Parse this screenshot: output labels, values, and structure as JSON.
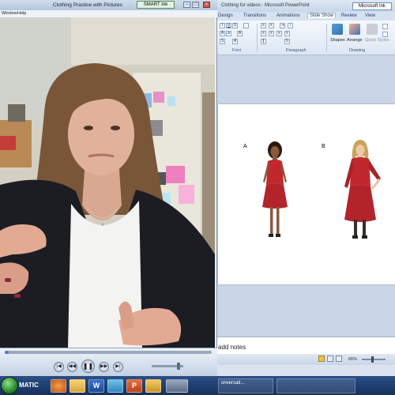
{
  "video_window": {
    "title": "Clothing Practice with Pictures",
    "smart_ink": "SMART Ink",
    "menu": [
      "Window",
      "Help"
    ],
    "controls": {
      "prev": "previous-icon",
      "rewind": "rewind-icon",
      "play_pause": "pause-icon",
      "fast_forward": "fast-forward-icon",
      "next": "next-icon"
    },
    "playback_progress": 0.02,
    "volume_level": 0.85
  },
  "ppt_window": {
    "title": "Clothing for videos - Microsoft PowerPoint",
    "smart_ink": "Microsoft Ink",
    "tabs": [
      "Design",
      "Transitions",
      "Animations",
      "Slide Show",
      "Review",
      "View"
    ],
    "active_tab": "Slide Show",
    "ribbon_groups": [
      "Font",
      "Paragraph",
      "Drawing"
    ],
    "ribbon_buttons": [
      "Shapes",
      "Arrange",
      "Quick Styles"
    ],
    "slide": {
      "label_a": "A",
      "label_b": "B"
    },
    "notes_placeholder": "add notes",
    "zoom": "66%"
  },
  "taskbar": {
    "start_label": "MATIC",
    "apps": [
      {
        "name": "firefox",
        "glyph": ""
      },
      {
        "name": "folder",
        "glyph": ""
      },
      {
        "name": "word",
        "glyph": "W"
      },
      {
        "name": "paint",
        "glyph": ""
      },
      {
        "name": "powerpoint",
        "glyph": "P"
      },
      {
        "name": "folder2",
        "glyph": ""
      },
      {
        "name": "video",
        "glyph": ""
      }
    ],
    "window_preview": "onversati..."
  },
  "colors": {
    "dress": "#c0282d",
    "ppt_accent": "#c55a11",
    "taskbar": "#1e3f72"
  }
}
